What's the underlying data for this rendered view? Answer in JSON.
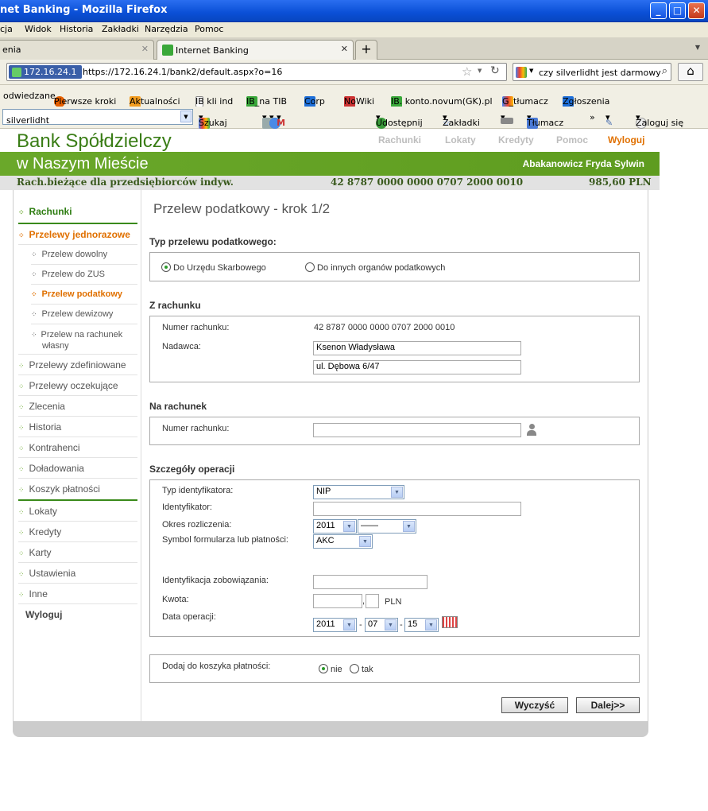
{
  "window": {
    "title": "net Banking - Mozilla Firefox"
  },
  "menu": [
    "cja",
    "Widok",
    "Historia",
    "Zakładki",
    "Narzędzia",
    "Pomoc"
  ],
  "tabs": [
    {
      "label": "enia"
    },
    {
      "label": "Internet Banking"
    }
  ],
  "address": {
    "ip": "172.16.24.1",
    "url": "https://172.16.24.1/bank2/default.aspx?o=16"
  },
  "search": {
    "value": "czy silverlidht jest darmowy"
  },
  "bookmarks": [
    "odwiedzane",
    "Pierwsze kroki",
    "Aktualności",
    "IB kli ind",
    "IB_na TIB",
    "Corp",
    "NoWiki",
    "IB. konto.novum(GK).pl",
    "G_tłumacz",
    "Zgłoszenia"
  ],
  "gtoolbar": {
    "input": "silverlidht",
    "items": [
      "Szukaj",
      "Udostępnij",
      "Zakładki",
      "Tłumacz",
      "»",
      "Zaloguj się"
    ]
  },
  "bank": {
    "name": "Bank Spółdzielczy",
    "city": "w Naszym Mieście",
    "user": "Abakanowicz Fryda Sylwin"
  },
  "topnav": [
    "Rachunki",
    "Lokaty",
    "Kredyty",
    "Pomoc",
    "Wyloguj"
  ],
  "account": {
    "name": "Rach.bieżące dla przedsiębiorców indyw.",
    "number": "42 8787 0000 0000 0707 2000 0010",
    "balance": "985,60 PLN"
  },
  "sidebar": {
    "rachunki": "Rachunki",
    "przelewy": "Przelewy jednorazowe",
    "sub": [
      "Przelew dowolny",
      "Przelew do ZUS",
      "Przelew podatkowy",
      "Przelew dewizowy",
      "Przelew na rachunek własny"
    ],
    "rest": [
      "Przelewy zdefiniowane",
      "Przelewy oczekujące",
      "Zlecenia",
      "Historia",
      "Kontrahenci",
      "Doładowania",
      "Koszyk płatności"
    ],
    "rest2": [
      "Lokaty",
      "Kredyty",
      "Karty",
      "Ustawienia",
      "Inne"
    ],
    "logout": "Wyloguj"
  },
  "form": {
    "title": "Przelew podatkowy - krok 1/2",
    "type_h": "Typ przelewu podatkowego:",
    "type_opt1": "Do Urzędu Skarbowego",
    "type_opt2": "Do innych organów podatkowych",
    "from_h": "Z rachunku",
    "from_num_lbl": "Numer rachunku:",
    "from_num": "42 8787 0000 0000 0707 2000 0010",
    "sender_lbl": "Nadawca:",
    "sender1": "Ksenon Władysława",
    "sender2": "ul. Dębowa 6/47",
    "to_h": "Na rachunek",
    "to_num_lbl": "Numer rachunku:",
    "details_h": "Szczegóły operacji",
    "idtype_lbl": "Typ identyfikatora:",
    "idtype": "NIP",
    "id_lbl": "Identyfikator:",
    "period_lbl": "Okres rozliczenia:",
    "period_year": "2011",
    "period_part": "——",
    "symbol_lbl": "Symbol formularza lub płatności:",
    "symbol": "AKC",
    "oblig_lbl": "Identyfikacja zobowiązania:",
    "amount_lbl": "Kwota:",
    "currency": "PLN",
    "comma": ",",
    "date_lbl": "Data operacji:",
    "date_y": "2011",
    "date_m": "07",
    "date_d": "15",
    "dash": "-",
    "basket_lbl": "Dodaj do koszyka płatności:",
    "basket_no": "nie",
    "basket_yes": "tak",
    "clear_btn": "Wyczyść",
    "next_btn": "Dalej>>"
  }
}
